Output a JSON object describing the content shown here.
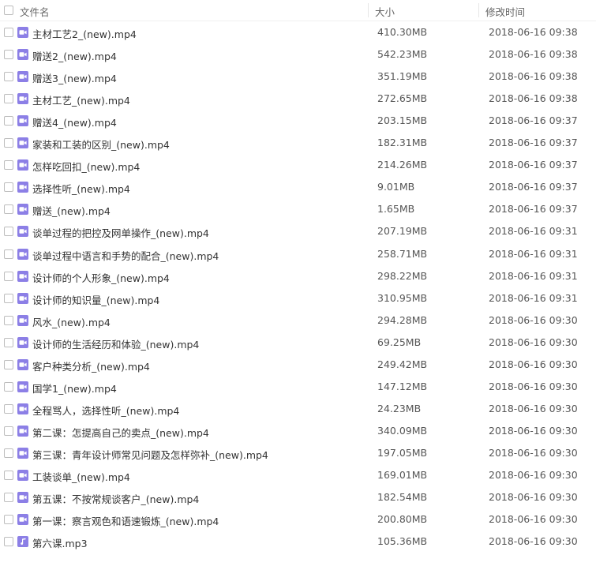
{
  "header": {
    "name": "文件名",
    "size": "大小",
    "modified": "修改时间"
  },
  "files": [
    {
      "name": "主材工艺2_(new).mp4",
      "size": "410.30MB",
      "date": "2018-06-16 09:38",
      "type": "video-icon"
    },
    {
      "name": "赠送2_(new).mp4",
      "size": "542.23MB",
      "date": "2018-06-16 09:38",
      "type": "video-icon"
    },
    {
      "name": "赠送3_(new).mp4",
      "size": "351.19MB",
      "date": "2018-06-16 09:38",
      "type": "video-icon"
    },
    {
      "name": "主材工艺_(new).mp4",
      "size": "272.65MB",
      "date": "2018-06-16 09:38",
      "type": "video-icon"
    },
    {
      "name": "赠送4_(new).mp4",
      "size": "203.15MB",
      "date": "2018-06-16 09:37",
      "type": "video-icon"
    },
    {
      "name": "家装和工装的区别_(new).mp4",
      "size": "182.31MB",
      "date": "2018-06-16 09:37",
      "type": "video-icon"
    },
    {
      "name": "怎样吃回扣_(new).mp4",
      "size": "214.26MB",
      "date": "2018-06-16 09:37",
      "type": "video-icon"
    },
    {
      "name": "选择性听_(new).mp4",
      "size": "9.01MB",
      "date": "2018-06-16 09:37",
      "type": "video-icon"
    },
    {
      "name": "赠送_(new).mp4",
      "size": "1.65MB",
      "date": "2018-06-16 09:37",
      "type": "video-icon"
    },
    {
      "name": "谈单过程的把控及网单操作_(new).mp4",
      "size": "207.19MB",
      "date": "2018-06-16 09:31",
      "type": "video-icon"
    },
    {
      "name": "谈单过程中语言和手势的配合_(new).mp4",
      "size": "258.71MB",
      "date": "2018-06-16 09:31",
      "type": "video-icon"
    },
    {
      "name": "设计师的个人形象_(new).mp4",
      "size": "298.22MB",
      "date": "2018-06-16 09:31",
      "type": "video-icon"
    },
    {
      "name": "设计师的知识量_(new).mp4",
      "size": "310.95MB",
      "date": "2018-06-16 09:31",
      "type": "video-icon"
    },
    {
      "name": "风水_(new).mp4",
      "size": "294.28MB",
      "date": "2018-06-16 09:30",
      "type": "video-icon"
    },
    {
      "name": "设计师的生活经历和体验_(new).mp4",
      "size": "69.25MB",
      "date": "2018-06-16 09:30",
      "type": "video-icon"
    },
    {
      "name": "客户种类分析_(new).mp4",
      "size": "249.42MB",
      "date": "2018-06-16 09:30",
      "type": "video-icon"
    },
    {
      "name": "国学1_(new).mp4",
      "size": "147.12MB",
      "date": "2018-06-16 09:30",
      "type": "video-icon"
    },
    {
      "name": "全程骂人，选择性听_(new).mp4",
      "size": "24.23MB",
      "date": "2018-06-16 09:30",
      "type": "video-icon"
    },
    {
      "name": "第二课：怎提高自己的卖点_(new).mp4",
      "size": "340.09MB",
      "date": "2018-06-16 09:30",
      "type": "video-icon"
    },
    {
      "name": "第三课：青年设计师常见问题及怎样弥补_(new).mp4",
      "size": "197.05MB",
      "date": "2018-06-16 09:30",
      "type": "video-icon"
    },
    {
      "name": "工装谈单_(new).mp4",
      "size": "169.01MB",
      "date": "2018-06-16 09:30",
      "type": "video-icon"
    },
    {
      "name": "第五课：不按常规谈客户_(new).mp4",
      "size": "182.54MB",
      "date": "2018-06-16 09:30",
      "type": "video-icon"
    },
    {
      "name": "第一课：察言观色和语速锻炼_(new).mp4",
      "size": "200.80MB",
      "date": "2018-06-16 09:30",
      "type": "video-icon"
    },
    {
      "name": "第六课.mp3",
      "size": "105.36MB",
      "date": "2018-06-16 09:30",
      "type": "audio-icon"
    }
  ],
  "colors": {
    "icon_purple": "#8c7fe6"
  }
}
